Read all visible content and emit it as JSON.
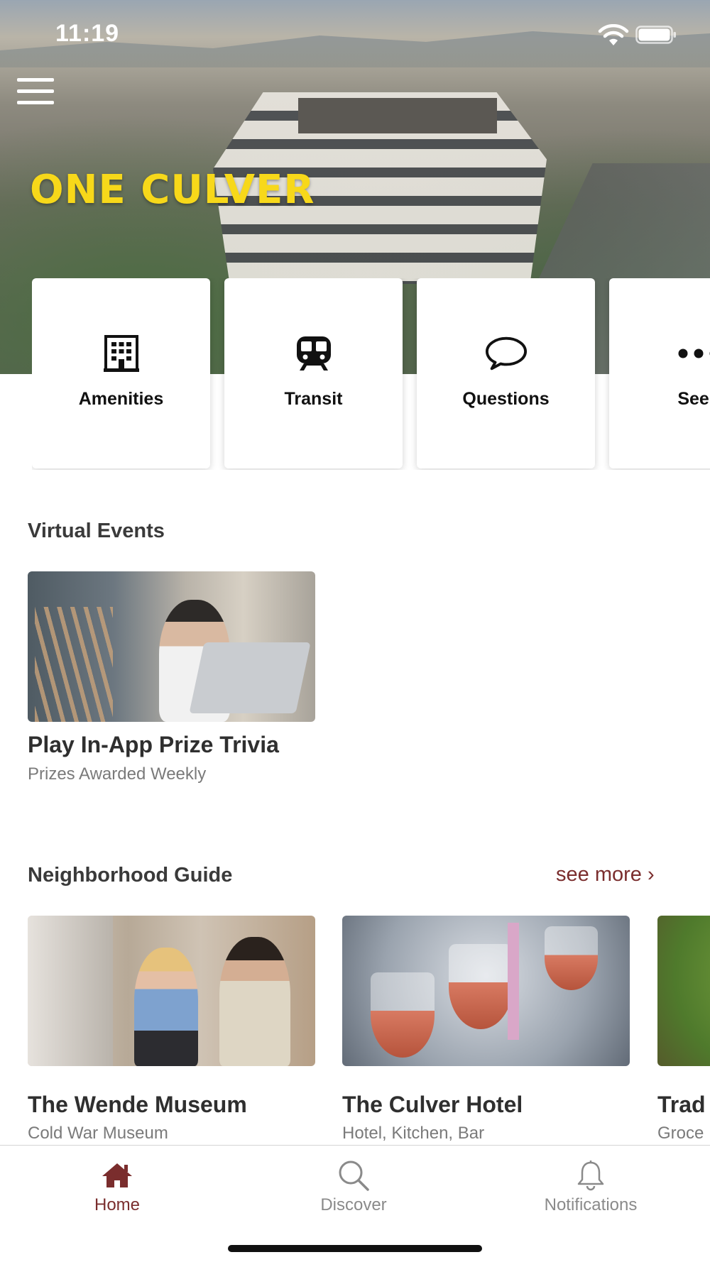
{
  "status_bar": {
    "time": "11:19"
  },
  "hero": {
    "brand": "ONE CULVER"
  },
  "quick_links": [
    {
      "label": "Amenities",
      "icon": "building-icon"
    },
    {
      "label": "Transit",
      "icon": "train-icon"
    },
    {
      "label": "Questions",
      "icon": "chat-bubble-icon"
    },
    {
      "label": "See I",
      "icon": "more-icon"
    }
  ],
  "virtual_events": {
    "title": "Virtual Events",
    "items": [
      {
        "title": "Play In-App Prize Trivia",
        "subtitle": "Prizes Awarded Weekly"
      }
    ]
  },
  "neighborhood_guide": {
    "title": "Neighborhood Guide",
    "see_more": "see more ›",
    "items": [
      {
        "title": "The Wende Museum",
        "subtitle": "Cold War Museum"
      },
      {
        "title": "The Culver Hotel",
        "subtitle": "Hotel, Kitchen, Bar"
      },
      {
        "title": "Trad",
        "subtitle": "Groce"
      }
    ]
  },
  "tab_bar": {
    "tabs": [
      {
        "label": "Home",
        "icon": "home-icon",
        "active": true
      },
      {
        "label": "Discover",
        "icon": "search-icon",
        "active": false
      },
      {
        "label": "Notifications",
        "icon": "bell-icon",
        "active": false
      }
    ]
  },
  "colors": {
    "accent": "#7a2d2d",
    "brand_yellow": "#f7d81a",
    "inactive": "#8a8a8a"
  }
}
